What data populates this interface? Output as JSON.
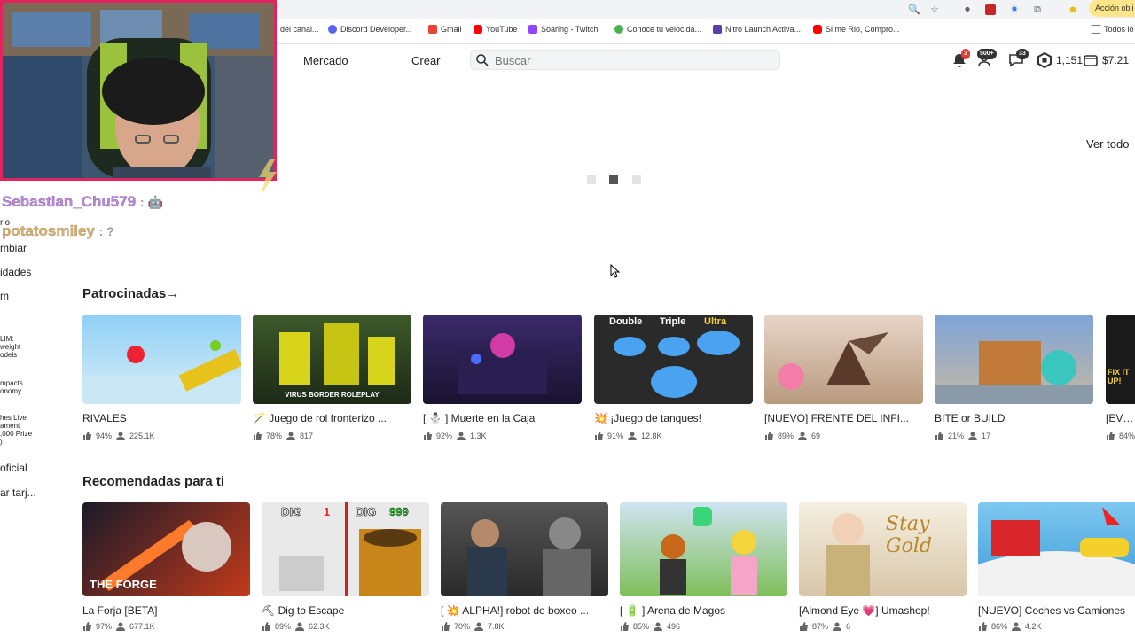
{
  "browser": {
    "action_label": "Acción obli",
    "bookmarks": [
      {
        "label": "del canal...",
        "color": "#cccccc"
      },
      {
        "label": "Discord Developer...",
        "color": "#5865f2"
      },
      {
        "label": "Gmail",
        "color": "#ea4335"
      },
      {
        "label": "YouTube",
        "color": "#ff0000"
      },
      {
        "label": "Soaring - Twitch",
        "color": "#9146ff"
      },
      {
        "label": "Conoce tu velocida...",
        "color": "#4caf50"
      },
      {
        "label": "Nitro Launch Activa...",
        "color": "#5b3fa6"
      },
      {
        "label": "Si me Rio, Compro...",
        "color": "#ff0000"
      },
      {
        "label": "Todos lo",
        "color": "#777777"
      }
    ]
  },
  "nav": {
    "market": "Mercado",
    "create": "Crear",
    "search_placeholder": "Buscar",
    "notifications_count": "3",
    "friends_count": "500+",
    "messages_count": "33",
    "robux": "1,151",
    "money": "$7.21"
  },
  "overlay": {
    "chat": [
      {
        "user": "Sebastian_Chu579",
        "message": ": 🤖",
        "color": "#b98ad6"
      },
      {
        "user": "potatosmiley",
        "message": ": ?",
        "color": "#d2b27a"
      }
    ]
  },
  "sidebar": {
    "items": [
      "rio",
      "mbiar",
      "idades",
      "m"
    ],
    "promo1": [
      "LIM:",
      "weight",
      "odels"
    ],
    "promo2": [
      "mpacts",
      "onomy"
    ],
    "promo3": [
      "hes Live",
      "ament",
      ",000 Prize",
      ")"
    ],
    "item_official": "oficial",
    "item_card": "ar tarj..."
  },
  "main": {
    "view_all": "Ver todo",
    "sponsored": {
      "title": "Patrocinadas",
      "arrow": "→",
      "games": [
        {
          "title": "RIVALES",
          "like": "94%",
          "players": "225.1K"
        },
        {
          "title": "🪄 Juego de rol fronterizo ...",
          "like": "78%",
          "players": "817",
          "thumb_text": "VIRUS BORDER ROLEPLAY"
        },
        {
          "title": "[ ⛄ ] Muerte en la Caja",
          "like": "92%",
          "players": "1.3K"
        },
        {
          "title": "💥 ¡Juego de tanques!",
          "like": "91%",
          "players": "12.8K",
          "thumb_labels": [
            "Double",
            "Triple",
            "Ultra"
          ]
        },
        {
          "title": "[NUEVO] FRENTE DEL INFI...",
          "like": "89%",
          "players": "69"
        },
        {
          "title": "BITE or BUILD",
          "like": "21%",
          "players": "17"
        },
        {
          "title": "[EVEN",
          "like": "84%",
          "players": "",
          "thumb_text": "FIX IT UP!"
        }
      ]
    },
    "recommended": {
      "title": "Recomendadas para ti",
      "games": [
        {
          "title": "La Forja [BETA]",
          "like": "97%",
          "players": "677.1K",
          "thumb_text": "THE FORGE"
        },
        {
          "title": "⛏ Dig to Escape",
          "like": "89%",
          "players": "62.3K",
          "thumb_labels": [
            "DIG",
            "1",
            "DIG",
            "999"
          ]
        },
        {
          "title": "[ 💥 ALPHA!] robot de boxeo ...",
          "like": "70%",
          "players": "7.8K"
        },
        {
          "title": "[ 🔋 ] Arena de Magos",
          "like": "85%",
          "players": "496"
        },
        {
          "title": "[Almond Eye 💗] Umashop!",
          "like": "87%",
          "players": "6",
          "thumb_text": "Stay Gold"
        },
        {
          "title": "[NUEVO] Coches vs Camiones",
          "like": "86%",
          "players": "4.2K"
        }
      ]
    }
  }
}
